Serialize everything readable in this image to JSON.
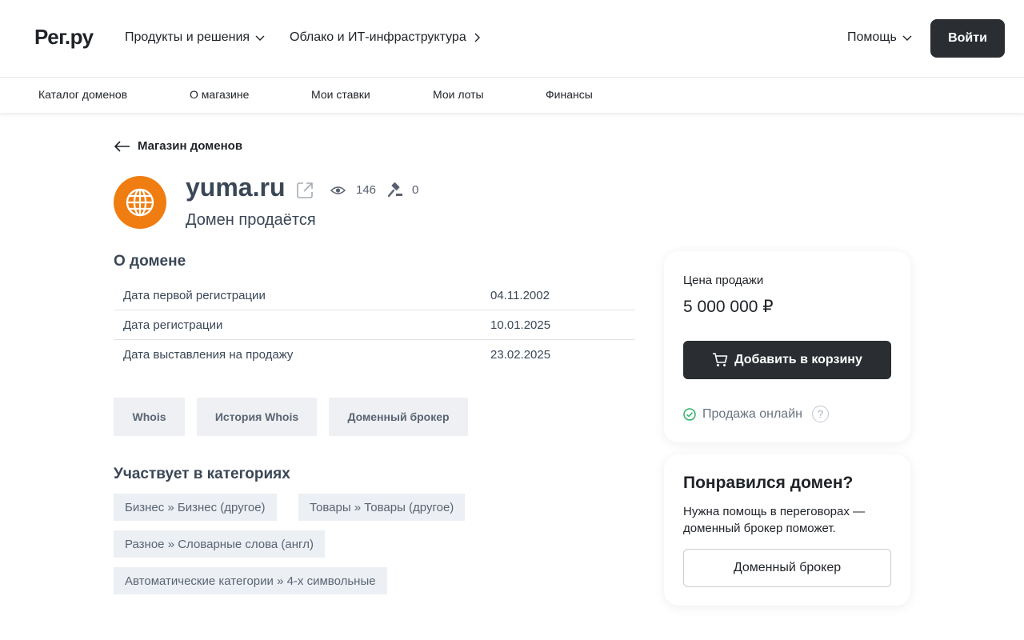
{
  "header": {
    "logo": "Рег.ру",
    "nav": [
      "Продукты и решения",
      "Облако и ИТ-инфраструктура"
    ],
    "help": "Помощь",
    "login": "Войти"
  },
  "subnav": [
    "Каталог доменов",
    "О магазине",
    "Мои ставки",
    "Мои лоты",
    "Финансы"
  ],
  "back_link": "Магазин доменов",
  "domain": {
    "name": "yuma.ru",
    "views": "146",
    "bids": "0",
    "status": "Домен продаётся"
  },
  "about": {
    "title": "О домене",
    "rows": [
      {
        "label": "Дата первой регистрации",
        "value": "04.11.2002"
      },
      {
        "label": "Дата регистрации",
        "value": "10.01.2025"
      },
      {
        "label": "Дата выставления на продажу",
        "value": "23.02.2025"
      }
    ]
  },
  "tools": [
    "Whois",
    "История Whois",
    "Доменный брокер"
  ],
  "categories": {
    "title": "Участвует в категориях",
    "tags": [
      "Бизнес » Бизнес (другое)",
      "Товары » Товары (другое)",
      "Разное » Словарные слова (англ)",
      "Автоматические категории » 4-х символьные"
    ]
  },
  "price_card": {
    "label": "Цена продажи",
    "price": "5 000 000 ₽",
    "cart_button": "Добавить в корзину",
    "online": "Продажа онлайн",
    "help_mark": "?"
  },
  "broker_card": {
    "title": "Понравился домен?",
    "text": "Нужна помощь в переговорах — доменный брокер поможет.",
    "button": "Доменный брокер"
  },
  "colors": {
    "accent_dark": "#2a2e33",
    "globe": "#f07d11",
    "online_check": "#2fb36b",
    "tag_bg": "#eceff4"
  }
}
